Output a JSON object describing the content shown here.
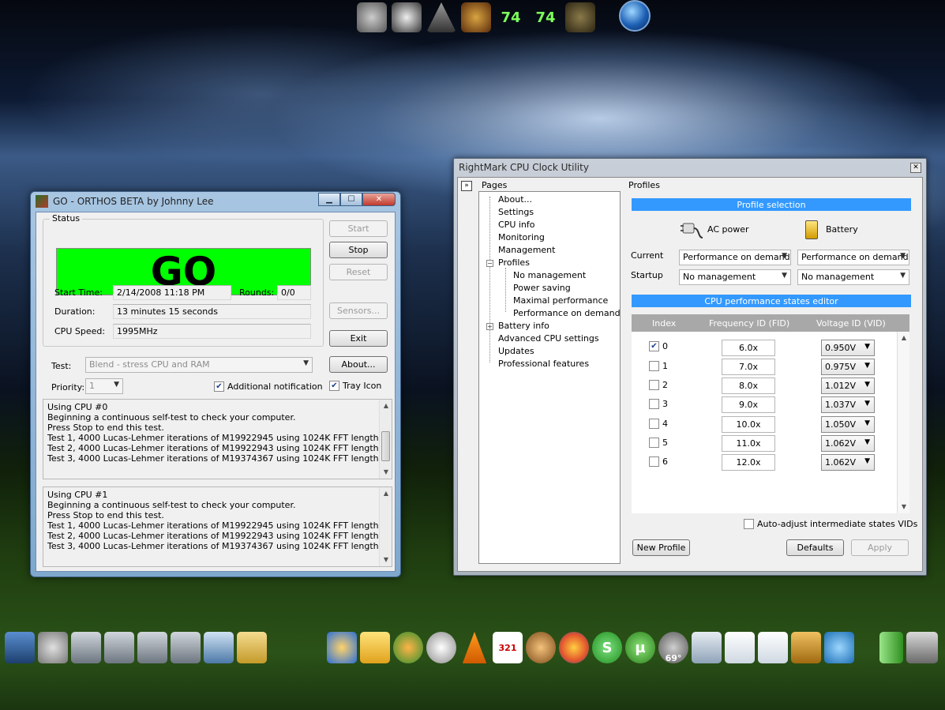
{
  "top_dock": {
    "icons": [
      "crysis-icon",
      "alien-icon",
      "pyramid-icon",
      "samurai-icon",
      "gauge-74-icon",
      "gauge-74-icon-2",
      "soldier-icon"
    ],
    "labels": [
      "",
      "",
      "",
      "",
      "74",
      "74",
      ""
    ]
  },
  "bottom_dock_left": {
    "icons": [
      "monitor-icon",
      "dvd-icon",
      "documents-icon",
      "pictures-icon",
      "videos-icon",
      "music-icon",
      "network-icon",
      "folder-icon"
    ]
  },
  "bottom_dock_right": {
    "icons": [
      "ie-icon",
      "mail-icon",
      "windows-icon",
      "refresh-icon",
      "vlc-icon",
      "calendar-icon",
      "monkey-icon",
      "firefox-icon",
      "skype-icon",
      "utorrent-icon",
      "weather-icon",
      "calculator-icon",
      "notes-icon",
      "chart-doc-icon",
      "arrows-icon",
      "network-share-icon"
    ],
    "labels": [
      "",
      "",
      "",
      "",
      "",
      "321",
      "",
      "",
      "S",
      "µ",
      "69°",
      "",
      "",
      "",
      "",
      ""
    ]
  },
  "bottom_dock_far_right": {
    "icons": [
      "battery-icon",
      "drive-icon"
    ]
  },
  "orthos": {
    "title": "GO - ORTHOS BETA by Johnny Lee",
    "status_label": "Status",
    "go_text": "GO",
    "start_time_label": "Start Time:",
    "start_time_value": "2/14/2008 11:18 PM",
    "rounds_label": "Rounds:",
    "rounds_value": "0/0",
    "duration_label": "Duration:",
    "duration_value": "13 minutes 15 seconds",
    "cpu_speed_label": "CPU Speed:",
    "cpu_speed_value": "1995MHz",
    "buttons": {
      "start": "Start",
      "stop": "Stop",
      "reset": "Reset",
      "sensors": "Sensors...",
      "exit": "Exit",
      "about": "About..."
    },
    "test_label": "Test:",
    "test_value": "Blend - stress CPU and RAM",
    "priority_label": "Priority:",
    "priority_value": "1",
    "additional_notification": "Additional notification",
    "tray_icon": "Tray Icon",
    "log_cpu0": [
      "Using CPU #0",
      "Beginning a continuous self-test to check your computer.",
      "Press Stop to end this test.",
      "Test 1, 4000 Lucas-Lehmer iterations of M19922945 using 1024K FFT length.",
      "Test 2, 4000 Lucas-Lehmer iterations of M19922943 using 1024K FFT length.",
      "Test 3, 4000 Lucas-Lehmer iterations of M19374367 using 1024K FFT length."
    ],
    "log_cpu1": [
      "Using CPU #1",
      "Beginning a continuous self-test to check your computer.",
      "Press Stop to end this test.",
      "Test 1, 4000 Lucas-Lehmer iterations of M19922945 using 1024K FFT length.",
      "Test 2, 4000 Lucas-Lehmer iterations of M19922943 using 1024K FFT length.",
      "Test 3, 4000 Lucas-Lehmer iterations of M19374367 using 1024K FFT length."
    ]
  },
  "rightmark": {
    "title": "RightMark CPU Clock Utility",
    "pages_label": "Pages",
    "profiles_label": "Profiles",
    "tree": {
      "about": "About...",
      "settings": "Settings",
      "cpu_info": "CPU info",
      "monitoring": "Monitoring",
      "management": "Management",
      "profiles": "Profiles",
      "no_management": "No management",
      "power_saving": "Power saving",
      "maximal_performance": "Maximal performance",
      "performance_on_demand": "Performance on demand",
      "battery_info": "Battery info",
      "advanced_cpu_settings": "Advanced CPU settings",
      "updates": "Updates",
      "professional_features": "Professional features"
    },
    "profile_selection": "Profile selection",
    "ac_power": "AC power",
    "battery": "Battery",
    "current_label": "Current",
    "startup_label": "Startup",
    "current_ac": "Performance on demand",
    "current_battery": "Performance on demand",
    "startup_ac": "No management",
    "startup_battery": "No management",
    "editor_title": "CPU performance states editor",
    "columns": {
      "index": "Index",
      "fid": "Frequency ID (FID)",
      "vid": "Voltage ID (VID)"
    },
    "states": [
      {
        "index": "0",
        "fid": "6.0x",
        "vid": "0.950V",
        "checked": "true"
      },
      {
        "index": "1",
        "fid": "7.0x",
        "vid": "0.975V",
        "checked": "false"
      },
      {
        "index": "2",
        "fid": "8.0x",
        "vid": "1.012V",
        "checked": "false"
      },
      {
        "index": "3",
        "fid": "9.0x",
        "vid": "1.037V",
        "checked": "false"
      },
      {
        "index": "4",
        "fid": "10.0x",
        "vid": "1.050V",
        "checked": "false"
      },
      {
        "index": "5",
        "fid": "11.0x",
        "vid": "1.062V",
        "checked": "false"
      },
      {
        "index": "6",
        "fid": "12.0x",
        "vid": "1.062V",
        "checked": "false"
      }
    ],
    "auto_adjust": "Auto-adjust intermediate states VIDs",
    "buttons": {
      "new_profile": "New Profile",
      "defaults": "Defaults",
      "apply": "Apply"
    }
  }
}
